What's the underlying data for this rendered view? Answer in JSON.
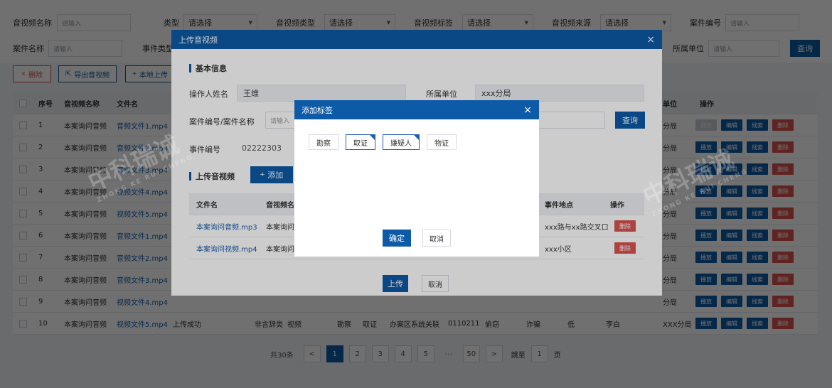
{
  "filters": {
    "row1": [
      {
        "label": "音视频名称",
        "type": "input",
        "placeholder": "请输入"
      },
      {
        "label": "类型",
        "type": "select",
        "value": "请选择"
      },
      {
        "label": "音视频类型",
        "type": "select",
        "value": "请选择"
      },
      {
        "label": "音视频标签",
        "type": "select",
        "value": "请选择"
      },
      {
        "label": "音视频来源",
        "type": "select",
        "value": "请选择"
      },
      {
        "label": "案件编号",
        "type": "input",
        "placeholder": "请输入"
      }
    ],
    "row2": [
      {
        "label": "案件名称",
        "type": "input",
        "placeholder": "请输入"
      },
      {
        "label": "事件类型",
        "type": "input",
        "placeholder": ""
      },
      {
        "label": "所属单位",
        "type": "input",
        "placeholder": "请输入"
      }
    ],
    "query_label": "查询"
  },
  "actions": {
    "delete_label": "删除",
    "export_label": "导出音视频",
    "local_upload_label": "本地上传"
  },
  "table": {
    "headers": {
      "seq": "序号",
      "name": "音视频名称",
      "file": "文件名",
      "unit": "单位",
      "ops": "操作"
    },
    "rows": [
      {
        "seq": "1",
        "name": "本案询问音频",
        "file": "音频文件1.mp4",
        "unit": "分局"
      },
      {
        "seq": "2",
        "name": "本案询问音频",
        "file": "音频文件2.mp4",
        "unit": "分局"
      },
      {
        "seq": "3",
        "name": "本案询问音频",
        "file": "音频文件3.mp4",
        "unit": "分局"
      },
      {
        "seq": "4",
        "name": "本案询问音频",
        "file": "视频文件4.mp4",
        "unit": "分局"
      },
      {
        "seq": "5",
        "name": "本案询问音频",
        "file": "视频文件5.mp4",
        "unit": "分局"
      },
      {
        "seq": "6",
        "name": "本案询问音频",
        "file": "音频文件1.mp4",
        "unit": "分局"
      },
      {
        "seq": "7",
        "name": "本案询问音频",
        "file": "音频文件2.mp4",
        "unit": "分局"
      },
      {
        "seq": "8",
        "name": "本案询问音频",
        "file": "音频文件3.mp4",
        "unit": "分局"
      },
      {
        "seq": "9",
        "name": "本案询问音频",
        "file": "视频文件4.mp4",
        "unit": "分局"
      },
      {
        "seq": "10",
        "name": "本案询问音频",
        "file": "视频文件5.mp4",
        "unit": "XXX分局"
      }
    ],
    "last_row_extra": [
      "上传成功",
      "非言辞类",
      "视频",
      "勘察",
      "取证",
      "办案区系统关联",
      "0110211",
      "偷窃",
      "诈骗",
      "低",
      "李白"
    ],
    "op_labels": {
      "play": "播放",
      "edit": "编辑",
      "clue": "线索",
      "delete": "删除"
    }
  },
  "pagination": {
    "total": "共30条",
    "prev": "<",
    "pages": [
      "1",
      "2",
      "3",
      "4",
      "5"
    ],
    "ellipsis": "···",
    "last": "50",
    "next": ">",
    "jump_label": "跳至",
    "jump_value": "1",
    "page_unit": "页"
  },
  "upload_modal": {
    "title": "上传音视频",
    "close": "×",
    "basic_info": "基本信息",
    "operator_label": "操作人姓名",
    "operator_value": "王维",
    "unit_label": "所属单位",
    "unit_value": "xxx分局",
    "case_label": "案件编号/案件名称",
    "case_placeholder": "请输入",
    "query_label": "查询",
    "event_no_label": "事件编号",
    "event_no_value": "02222303",
    "upload_section": "上传音视频",
    "add_label": "添加",
    "table_headers": {
      "file": "文件名",
      "name": "音视频名",
      "place": "事件地点",
      "op": "操作"
    },
    "rows": [
      {
        "file": "本案询问音频.mp3",
        "name": "本案询问",
        "place": "xxx路与xx路交叉口",
        "op": "删除"
      },
      {
        "file": "本案询问视频.mp4",
        "name": "本案询问",
        "place": "xxx小区",
        "op": "删除"
      }
    ],
    "upload_btn": "上传",
    "cancel_btn": "取消"
  },
  "tag_modal": {
    "title": "添加标签",
    "close": "×",
    "tags": [
      {
        "label": "勘察",
        "selected": false
      },
      {
        "label": "取证",
        "selected": true
      },
      {
        "label": "嫌疑人",
        "selected": true
      },
      {
        "label": "物证",
        "selected": false
      }
    ],
    "confirm": "确定",
    "cancel": "取消"
  },
  "watermark": {
    "cn": "中科瑞诚",
    "en": "ZHONG KE RUI CHENG"
  },
  "colors": {
    "primary": "#0d5aa7",
    "danger": "#d9534f"
  }
}
